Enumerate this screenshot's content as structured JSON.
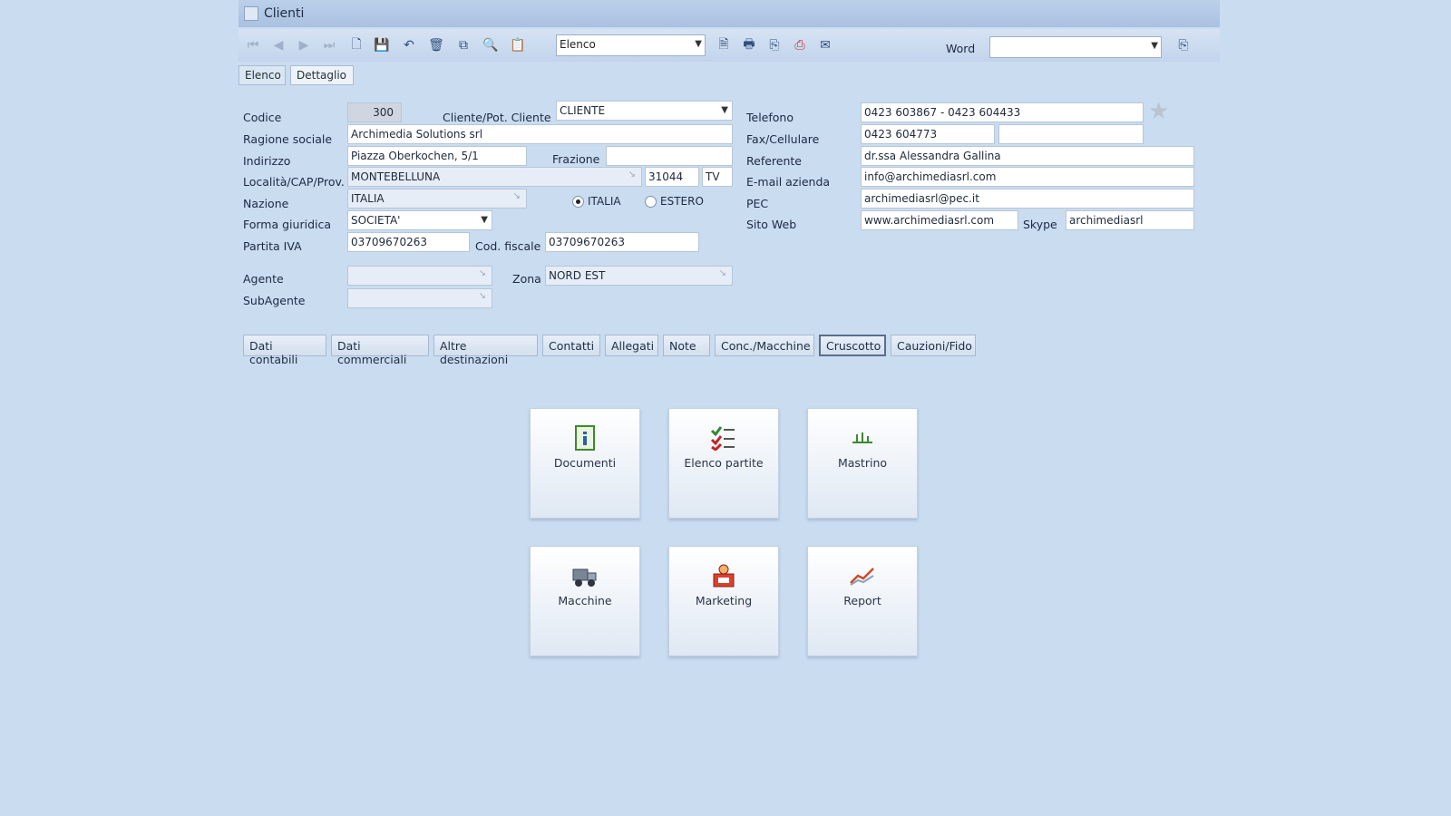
{
  "window": {
    "title": "Clienti"
  },
  "toolbar": {
    "view_select": "Elenco",
    "word_label": "Word",
    "word_select": ""
  },
  "view_tabs": [
    {
      "label": "Elenco"
    },
    {
      "label": "Dettaglio"
    }
  ],
  "form": {
    "codice_label": "Codice",
    "codice_value": "300",
    "tipo_label": "Cliente/Pot. Cliente",
    "tipo_value": "CLIENTE",
    "ragione_label": "Ragione sociale",
    "ragione_value": "Archimedia Solutions srl",
    "indirizzo_label": "Indirizzo",
    "indirizzo_value": "Piazza Oberkochen, 5/1",
    "frazione_label": "Frazione",
    "frazione_value": "",
    "localita_label": "Località/CAP/Prov.",
    "localita_value": "MONTEBELLUNA",
    "cap_value": "31044",
    "prov_value": "TV",
    "nazione_label": "Nazione",
    "nazione_value": "ITALIA",
    "radio_italia": "ITALIA",
    "radio_estero": "ESTERO",
    "forma_label": "Forma giuridica",
    "forma_value": "SOCIETA'",
    "piva_label": "Partita IVA",
    "piva_value": "03709670263",
    "codfisc_label": "Cod. fiscale",
    "codfisc_value": "03709670263",
    "agente_label": "Agente",
    "agente_value": "",
    "subagente_label": "SubAgente",
    "subagente_value": "",
    "zona_label": "Zona",
    "zona_value": "NORD EST",
    "telefono_label": "Telefono",
    "telefono_value": "0423 603867 - 0423 604433",
    "fax_label": "Fax/Cellulare",
    "fax_value": "0423 604773",
    "cell_value": "",
    "referente_label": "Referente",
    "referente_value": "dr.ssa Alessandra Gallina",
    "email_label": "E-mail azienda",
    "email_value": "info@archimediasrl.com",
    "pec_label": "PEC",
    "pec_value": "archimediasrl@pec.it",
    "sito_label": "Sito Web",
    "sito_value": "www.archimediasrl.com",
    "skype_label": "Skype",
    "skype_value": "archimediasrl"
  },
  "sub_tabs": [
    {
      "label": "Dati contabili"
    },
    {
      "label": "Dati commerciali"
    },
    {
      "label": "Altre destinazioni"
    },
    {
      "label": "Contatti"
    },
    {
      "label": "Allegati"
    },
    {
      "label": "Note"
    },
    {
      "label": "Conc./Macchine"
    },
    {
      "label": "Cruscotto"
    },
    {
      "label": "Cauzioni/Fido"
    }
  ],
  "tiles": [
    {
      "label": "Documenti",
      "icon": "document-info-icon"
    },
    {
      "label": "Elenco partite",
      "icon": "checklist-icon"
    },
    {
      "label": "Mastrino",
      "icon": "ledger-icon"
    },
    {
      "label": "Macchine",
      "icon": "truck-icon"
    },
    {
      "label": "Marketing",
      "icon": "marketing-icon"
    },
    {
      "label": "Report",
      "icon": "chart-icon"
    }
  ],
  "colors": {
    "background": "#cadcf0",
    "toolbar": "#c2d4ec",
    "active_tab_border": "#5a6f8c"
  }
}
